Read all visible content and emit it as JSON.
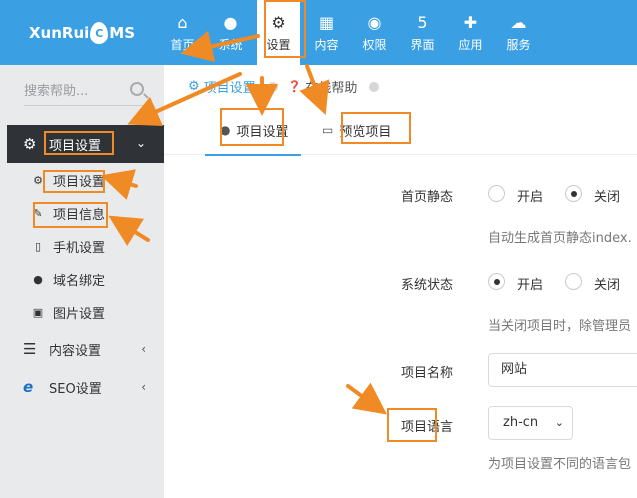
{
  "brand": {
    "logo_left": "XunRui",
    "logo_drop": "C",
    "logo_right": "MS"
  },
  "nav": [
    {
      "label": "首页",
      "icon": "home-icon",
      "glyph": "⌂"
    },
    {
      "label": "系统",
      "icon": "globe-icon",
      "glyph": "●"
    },
    {
      "label": "设置",
      "icon": "gears-icon",
      "glyph": "⚙"
    },
    {
      "label": "内容",
      "icon": "grid-icon",
      "glyph": "▦"
    },
    {
      "label": "权限",
      "icon": "user-icon",
      "glyph": "◉"
    },
    {
      "label": "界面",
      "icon": "html5-icon",
      "glyph": "5"
    },
    {
      "label": "应用",
      "icon": "puzzle-icon",
      "glyph": "✚"
    },
    {
      "label": "服务",
      "icon": "cloud-icon",
      "glyph": "☁"
    }
  ],
  "sidebar": {
    "search_placeholder": "搜索帮助...",
    "menu_head": {
      "label": "项目设置",
      "icon": "gear-icon",
      "glyph": "⚙",
      "chev": "⌄"
    },
    "sub_items": [
      {
        "label": "项目设置",
        "icon": "gears-icon",
        "glyph": "⚙"
      },
      {
        "label": "项目信息",
        "icon": "edit-icon",
        "glyph": "✎"
      },
      {
        "label": "手机设置",
        "icon": "mobile-icon",
        "glyph": "▯"
      },
      {
        "label": "域名绑定",
        "icon": "globe-icon",
        "glyph": "●"
      },
      {
        "label": "图片设置",
        "icon": "image-icon",
        "glyph": "▣"
      }
    ],
    "groups": [
      {
        "label": "内容设置",
        "icon": "bars-icon",
        "glyph": "☰",
        "chev": "‹"
      },
      {
        "label": "SEO设置",
        "icon": "ie-icon",
        "glyph": "e",
        "chev": "‹"
      }
    ]
  },
  "breadcrumb": {
    "current": "项目设置",
    "help": "在线帮助",
    "gear": "⚙",
    "help_glyph": "❓"
  },
  "tabs": [
    {
      "label": "项目设置",
      "icon": "globe-icon",
      "glyph": "●"
    },
    {
      "label": "预览项目",
      "icon": "monitor-icon",
      "glyph": "▭"
    }
  ],
  "form": {
    "static": {
      "label": "首页静态",
      "opt_on": "开启",
      "opt_off": "关闭",
      "help": "自动生成首页静态index."
    },
    "status": {
      "label": "系统状态",
      "opt_on": "开启",
      "opt_off": "关闭",
      "help": "当关闭项目时，除管理员"
    },
    "name": {
      "label": "项目名称",
      "value": "网站"
    },
    "lang": {
      "label": "项目语言",
      "value": "zh-cn",
      "arrow": "⌄",
      "help": "为项目设置不同的语言包"
    }
  },
  "colors": {
    "topbar": "#3aa0e3",
    "highlight": "#f08a24",
    "sidebar": "#e9eaec",
    "menu_active": "#2f3236"
  }
}
